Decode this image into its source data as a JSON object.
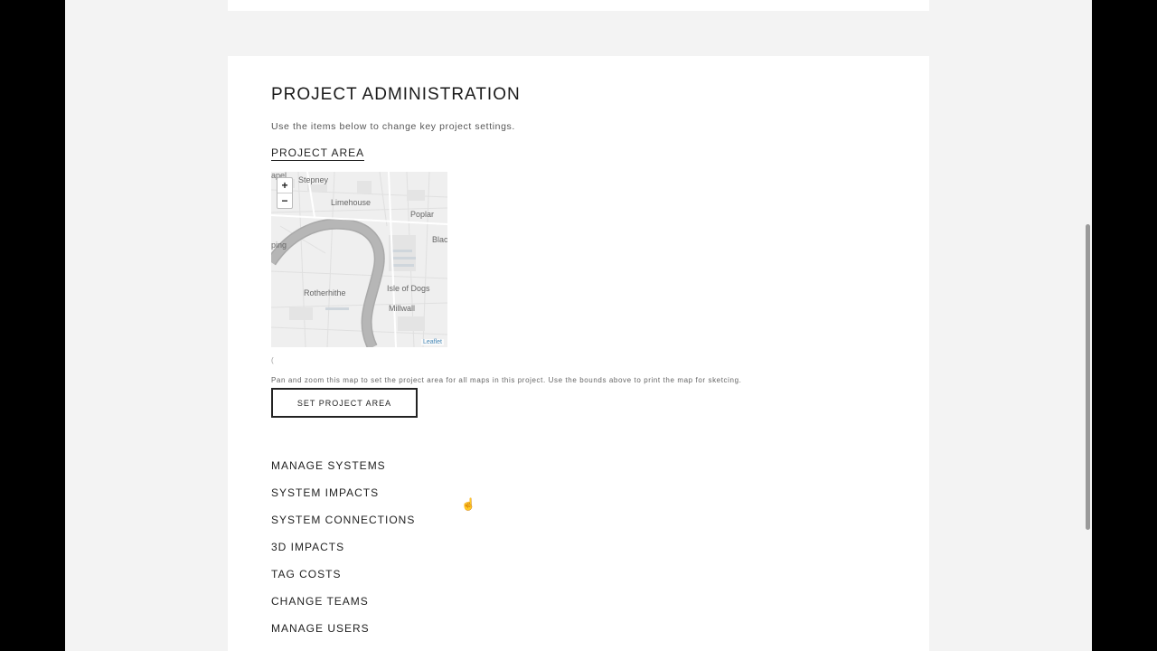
{
  "page": {
    "title": "PROJECT ADMINISTRATION",
    "intro": "Use the items below to change key project settings."
  },
  "project_area": {
    "heading": "PROJECT AREA",
    "map": {
      "labels": [
        "Stepney",
        "Limehouse",
        "Poplar",
        "Rotherhithe",
        "Isle of Dogs",
        "Millwall",
        "Blac",
        "ping",
        "apel"
      ],
      "zoom_in": "+",
      "zoom_out": "−",
      "attribution": "Leaflet"
    },
    "bounds_text": "(",
    "hint": "Pan and zoom this map to set the project area for all maps in this project. Use the bounds above to print the map for sketcing.",
    "button_label": "SET PROJECT AREA"
  },
  "menu": {
    "items": [
      "MANAGE SYSTEMS",
      "SYSTEM IMPACTS",
      "SYSTEM CONNECTIONS",
      "3D IMPACTS",
      "TAG COSTS",
      "CHANGE TEAMS",
      "MANAGE USERS"
    ]
  },
  "colors": {
    "background": "#f3f3f3",
    "card": "#ffffff",
    "text": "#222222",
    "river": "#a9a9a9",
    "map_base": "#efefef"
  }
}
